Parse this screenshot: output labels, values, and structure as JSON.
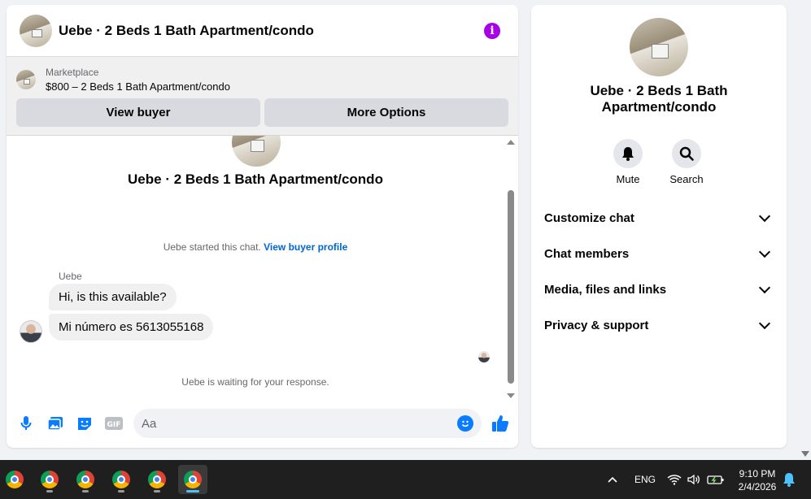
{
  "chat": {
    "title": "Uebe · 2 Beds 1 Bath Apartment/condo",
    "marketplace_label": "Marketplace",
    "listing": "$800 – 2 Beds 1 Bath Apartment/condo",
    "view_buyer": "View buyer",
    "more_options": "More Options",
    "thread_title": "Uebe · 2 Beds 1 Bath Apartment/condo",
    "started_text": "Uebe started this chat.",
    "view_buyer_profile": "View buyer profile",
    "sender": "Uebe",
    "messages": [
      "Hi, is this available?",
      "Mi número es 5613055168"
    ],
    "waiting": "Uebe is waiting for your response.",
    "input_placeholder": "Aa"
  },
  "side": {
    "title": "Uebe · 2 Beds 1 Bath Apartment/condo",
    "mute": "Mute",
    "search": "Search",
    "sections": [
      "Customize chat",
      "Chat members",
      "Media, files and links",
      "Privacy & support"
    ]
  },
  "taskbar": {
    "lang": "ENG",
    "time": "9:10 PM",
    "date": "2/4/2026"
  },
  "colors": {
    "accent_blue": "#0a7cff",
    "info_purple": "#a800e5",
    "link_blue": "#0064d1"
  }
}
